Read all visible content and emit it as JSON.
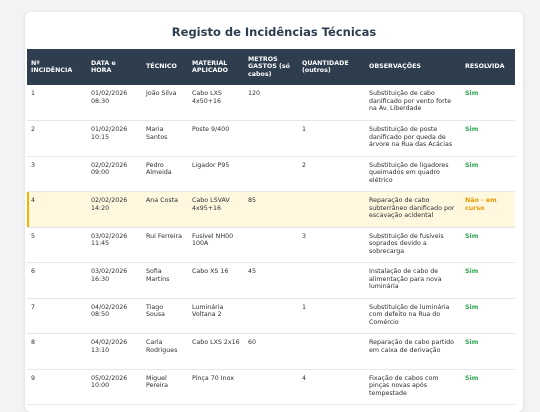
{
  "title": "Registo de Incidências Técnicas",
  "headers": {
    "num": "Nº INCIDÊNCIA",
    "date": "DATA e HORA",
    "tech": "TÉCNICO",
    "material": "MATERIAL APLICADO",
    "meters": "METROS GASTOS (só cabos)",
    "qty": "QUANTIDADE (outros)",
    "obs": "OBSERVAÇÕES",
    "resolved": "RESOLVIDA"
  },
  "rows": [
    {
      "num": "1",
      "date": "01/02/2026 08:30",
      "tech": "João Silva",
      "material": "Cabo LXS 4x50+16",
      "meters": "120",
      "qty": "",
      "obs": "Substituição de cabo danificado por vento forte na Av. Liberdade",
      "resolved": "Sim"
    },
    {
      "num": "2",
      "date": "01/02/2026 10:15",
      "tech": "Maria Santos",
      "material": "Poste 9/400",
      "meters": "",
      "qty": "1",
      "obs": "Substituição de poste danificado por queda de árvore na Rua das Acácias",
      "resolved": "Sim"
    },
    {
      "num": "3",
      "date": "02/02/2026 09:00",
      "tech": "Pedro Almeida",
      "material": "Ligador P95",
      "meters": "",
      "qty": "2",
      "obs": "Substituição de ligadores queimados em quadro elétrico",
      "resolved": "Sim"
    },
    {
      "num": "4",
      "date": "02/02/2026 14:20",
      "tech": "Ana Costa",
      "material": "Cabo LSVAV 4x95+16",
      "meters": "85",
      "qty": "",
      "obs": "Reparação de cabo subterrâneo danificado por escavação acidental",
      "resolved": "Não - em curso"
    },
    {
      "num": "5",
      "date": "03/02/2026 11:45",
      "tech": "Rui Ferreira",
      "material": "Fusível NH00 100A",
      "meters": "",
      "qty": "3",
      "obs": "Substituição de fusíveis soprados devido a sobrecarga",
      "resolved": "Sim"
    },
    {
      "num": "6",
      "date": "03/02/2026 16:30",
      "tech": "Sofia Martins",
      "material": "Cabo XS 16",
      "meters": "45",
      "qty": "",
      "obs": "Instalação de cabo de alimentação para nova luminária",
      "resolved": "Sim"
    },
    {
      "num": "7",
      "date": "04/02/2026 08:50",
      "tech": "Tiago Sousa",
      "material": "Luminária Voltana 2",
      "meters": "",
      "qty": "1",
      "obs": "Substituição de luminária com defeito na Rua do Comércio",
      "resolved": "Sim"
    },
    {
      "num": "8",
      "date": "04/02/2026 13:10",
      "tech": "Carla Rodrigues",
      "material": "Cabo LXS 2x16",
      "meters": "60",
      "qty": "",
      "obs": "Reparação de cabo partido em caixa de derivação",
      "resolved": "Sim"
    },
    {
      "num": "9",
      "date": "05/02/2026 10:00",
      "tech": "Miguel Pereira",
      "material": "Pinça 70 Inox",
      "meters": "",
      "qty": "4",
      "obs": "Fixação de cabos com pinças novas após tempestade",
      "resolved": "Sim"
    }
  ],
  "colors": {
    "header_bg": "#2f3e4f",
    "resolved_yes": "#2ea44f",
    "resolved_no": "#e69b00",
    "pending_row_bg": "#fff8df"
  }
}
